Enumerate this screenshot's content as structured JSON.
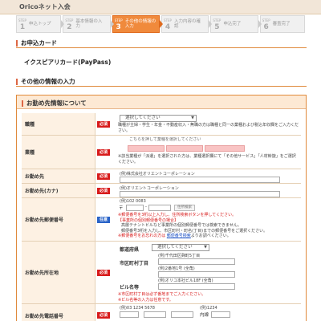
{
  "header": {
    "title": "Oricoネット入会"
  },
  "steps": [
    {
      "step": "STEP",
      "num": "1",
      "label": "申込トップ"
    },
    {
      "step": "STEP",
      "num": "2",
      "label": "基本情報の入力"
    },
    {
      "step": "STEP",
      "num": "3",
      "label": "その他の情報の入力"
    },
    {
      "step": "STEP",
      "num": "4",
      "label": "入力内容の確認"
    },
    {
      "step": "STEP",
      "num": "5",
      "label": "申込完了"
    },
    {
      "step": "STEP",
      "num": "6",
      "label": "審査完了"
    }
  ],
  "active_step": 3,
  "apply_card": {
    "heading": "お申込カード",
    "card_name": "イクスピアリカード(PayPass)"
  },
  "other_info_heading": "その他の情報の入力",
  "work": {
    "heading": "お勤め先情報について",
    "required": "必須",
    "optional": "任意",
    "occupation": {
      "label": "職種",
      "select": "選択してください",
      "note": "職種が主婦・学生・年金・不動産収入・無職の方は職種と同一の業種および税込年収欄をご入力ください。"
    },
    "industry": {
      "label": "業種",
      "hint": "こちらを押して業種を選択してください",
      "note": "※該当業種が「派遣」を選択された方は、業種選択欄にて「その他サービス」「人材斡旋」をご選択ください。"
    },
    "company": {
      "label": "お勤め先",
      "placeholder": "(例)株式会社オリエントコーポレーション"
    },
    "company_kana": {
      "label": "お勤め先(カナ)",
      "placeholder": "(例)オリエントコーポレーション"
    },
    "postal": {
      "label": "お勤め先郵便番号",
      "example": "(例)102     0083",
      "mark": "〒",
      "search": "住所検索",
      "notes": [
        "※郵便番号を3桁以上入力し、住所検索ボタンを押してください。",
        "【事業所の個別郵便番号の場合】",
        "高層テナントビルなど事業所の個別郵便番号では検索できません。",
        "郵便番号3桁を入力し、市区町村・町名(丁目)までの郵便番号をご選択ください。",
        "※郵便番号をお忘れの方は"
      ],
      "link": "郵便番号検索",
      "link_tail": "よりお調べください。"
    },
    "address": {
      "label": "お勤め先所在地",
      "prefecture": "都道府県",
      "pref_select": "選択してください",
      "city": "市区町村丁目",
      "city_example": "(例)千代田区麹町5丁目",
      "number_example": "(例)2番地1号  (全角)",
      "building": "ビル名等",
      "building_example": "(例)オリコ本社ビル18F  (全角)",
      "notes": [
        "※市区町村丁目は必ず番地までご入力ください。",
        "※ビル名等の入力は任意です。"
      ]
    },
    "phone": {
      "label": "お勤め先電話番号",
      "example": "(例)03     1234     5678",
      "ext_example": "(例)1234",
      "ext": "内線"
    }
  },
  "colors": {
    "accent": "#f08a3c",
    "required": "#d81b1b",
    "optional": "#2a64c8",
    "label_bg": "#fdf1e3"
  }
}
